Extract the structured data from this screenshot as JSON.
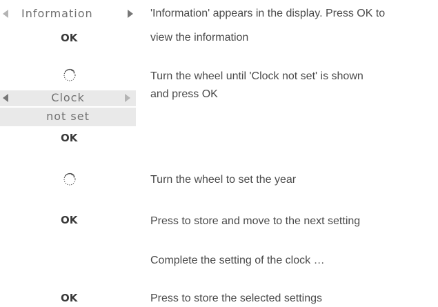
{
  "steps": [
    {
      "display": {
        "left_arrow": "◀",
        "label": "Information",
        "right_arrow": "▶"
      },
      "button": "OK",
      "description_lines": [
        "'Information' appears in the display. Press OK to",
        "view the information"
      ]
    },
    {
      "wheel_icon": "rotation-wheel-icon",
      "display": {
        "left_arrow": "◀",
        "label_line1": "Clock",
        "label_line2": "not set",
        "right_arrow": "▶"
      },
      "button": "OK",
      "description_lines": [
        "Turn the wheel until 'Clock not set' is shown",
        "and press OK"
      ]
    },
    {
      "wheel_icon": "rotation-wheel-icon",
      "description": "Turn the wheel to set the year"
    },
    {
      "button": "OK",
      "description": "Press to store and move to the next setting"
    },
    {
      "description": "Complete the setting of the clock …"
    },
    {
      "button": "OK",
      "description": "Press to store the selected settings"
    }
  ],
  "colors": {
    "display_bg": "#e9e9e9",
    "display_text": "#6f6f6f",
    "body_text": "#4a4a4a",
    "arrow_dark": "#777777",
    "arrow_light": "#b4b4b4"
  }
}
